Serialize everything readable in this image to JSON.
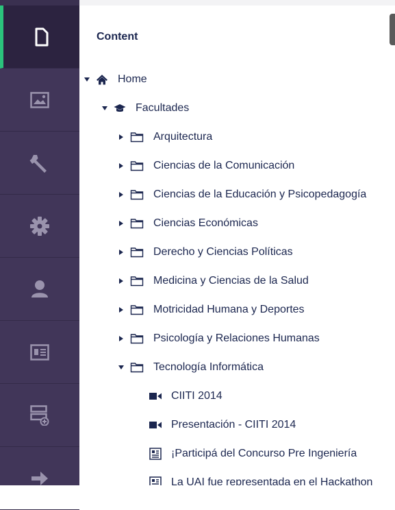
{
  "sidebar": {
    "items": [
      {
        "name": "content",
        "icon": "document-icon"
      },
      {
        "name": "media",
        "icon": "image-icon"
      },
      {
        "name": "settings",
        "icon": "wrench-icon"
      },
      {
        "name": "developer",
        "icon": "gear-icon"
      },
      {
        "name": "users",
        "icon": "user-icon"
      },
      {
        "name": "members",
        "icon": "member-card-icon"
      },
      {
        "name": "forms",
        "icon": "form-add-icon"
      },
      {
        "name": "translation",
        "icon": "arrow-right-icon"
      }
    ],
    "active_color": "#2bc37c",
    "background": "#413659"
  },
  "panel": {
    "title": "Content"
  },
  "tree": {
    "home": {
      "label": "Home",
      "icon": "home-icon"
    },
    "facultades": {
      "label": "Facultades",
      "icon": "graduation-cap-icon"
    },
    "folders": [
      "Arquitectura",
      "Ciencias de la Comunicación",
      "Ciencias de la Educación y Psicopedagogía",
      "Ciencias Económicas",
      "Derecho y Ciencias Políticas",
      "Medicina y Ciencias de la Salud",
      "Motricidad Humana y Deportes",
      "Psicología y Relaciones Humanas",
      "Tecnología Informática"
    ],
    "children": [
      {
        "label": "CIITI 2014",
        "icon": "video-icon"
      },
      {
        "label": "Presentación - CIITI 2014",
        "icon": "video-icon"
      },
      {
        "label": "¡Participá del Concurso Pre Ingeniería",
        "icon": "news-icon"
      },
      {
        "label": "La UAI fue representada en el Hackathon",
        "icon": "news-icon"
      }
    ]
  }
}
